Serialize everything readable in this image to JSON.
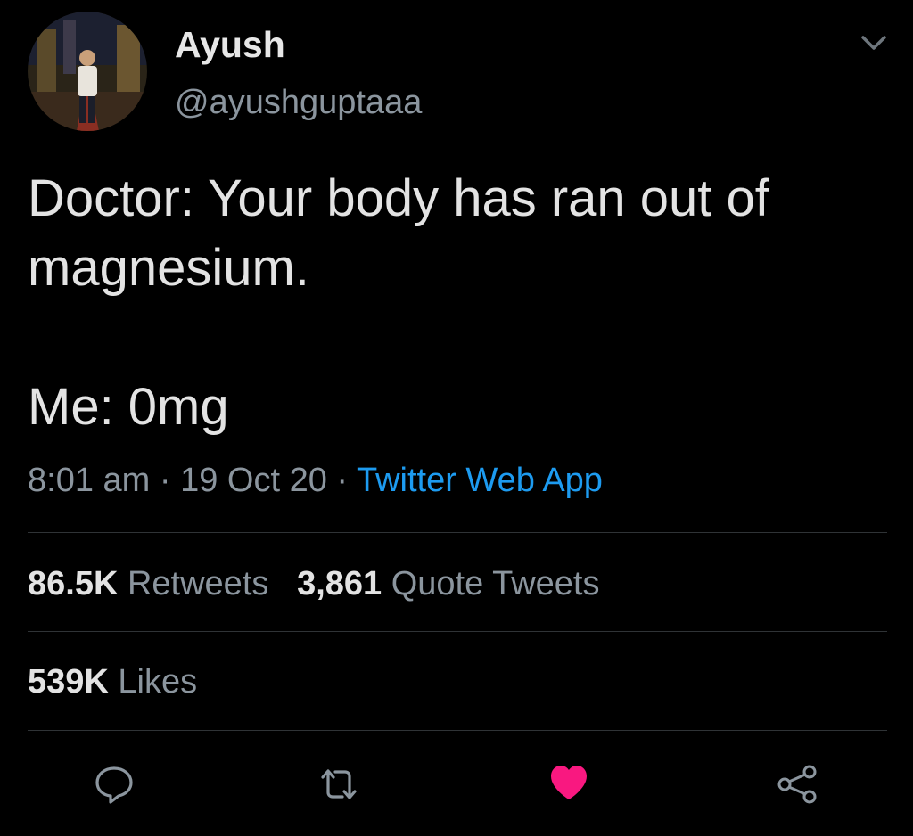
{
  "author": {
    "display_name": "Ayush",
    "handle": "@ayushguptaaa",
    "avatar_icon": "profile-photo"
  },
  "tweet": {
    "lines": [
      "Doctor: Your body has ran out of",
      "magnesium."
    ],
    "reply_line": "Me: 0mg"
  },
  "meta": {
    "time": "8:01 am",
    "sep1": " · ",
    "date": "19 Oct 20",
    "sep2": " · ",
    "source": "Twitter Web App"
  },
  "stats": {
    "retweets_count": "86.5K",
    "retweets_label": "Retweets",
    "quotes_count": "3,861",
    "quotes_label": "Quote Tweets",
    "likes_count": "539K",
    "likes_label": "Likes"
  },
  "actions": {
    "reply_icon": "speech-bubble-icon",
    "retweet_icon": "retweet-arrows-icon",
    "like_icon": "heart-icon",
    "share_icon": "share-nodes-icon",
    "liked": true
  },
  "colors": {
    "background": "#000000",
    "text": "#e3e3e3",
    "secondary": "#8b959e",
    "link": "#1d9bf0",
    "like": "#f91880",
    "divider": "#2f3336"
  }
}
